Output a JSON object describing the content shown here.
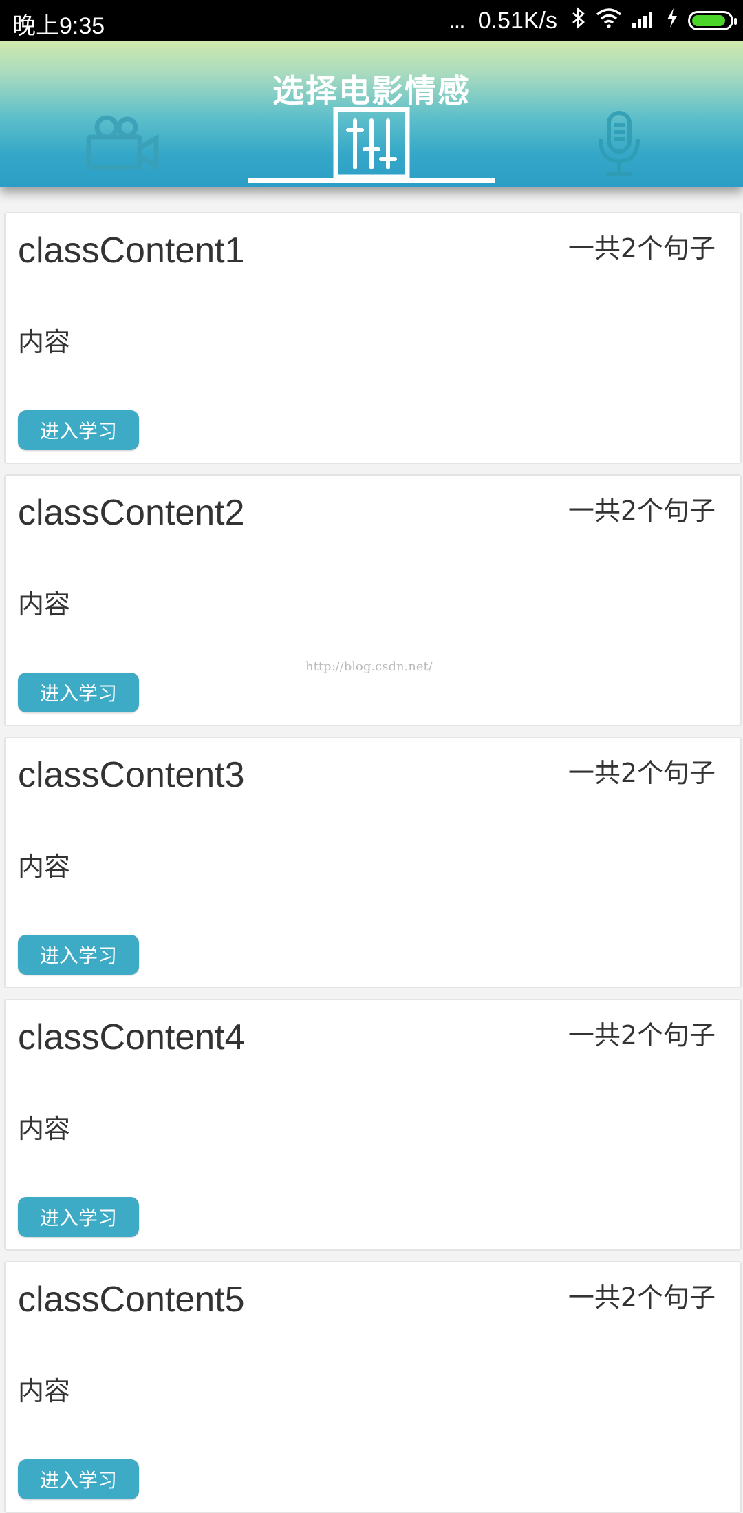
{
  "status_bar": {
    "time": "晚上9:35",
    "dots": "...",
    "net_speed": "0.51K/s",
    "battery_level": 0.9,
    "battery_color": "#4bd42a"
  },
  "header": {
    "title": "选择电影情感",
    "tabs": [
      {
        "icon": "video-camera-icon",
        "selected": false
      },
      {
        "icon": "equalizer-icon",
        "selected": true
      },
      {
        "icon": "microphone-icon",
        "selected": false
      }
    ],
    "accent": "#2c9ec6"
  },
  "list": {
    "items": [
      {
        "title": "classContent1",
        "count": "一共2个句子",
        "desc": "内容",
        "button": "进入学习"
      },
      {
        "title": "classContent2",
        "count": "一共2个句子",
        "desc": "内容",
        "button": "进入学习"
      },
      {
        "title": "classContent3",
        "count": "一共2个句子",
        "desc": "内容",
        "button": "进入学习"
      },
      {
        "title": "classContent4",
        "count": "一共2个句子",
        "desc": "内容",
        "button": "进入学习"
      },
      {
        "title": "classContent5",
        "count": "一共2个句子",
        "desc": "内容",
        "button": "进入学习"
      }
    ],
    "button_color": "#3eabc6"
  },
  "watermark": "http://blog.csdn.net/"
}
